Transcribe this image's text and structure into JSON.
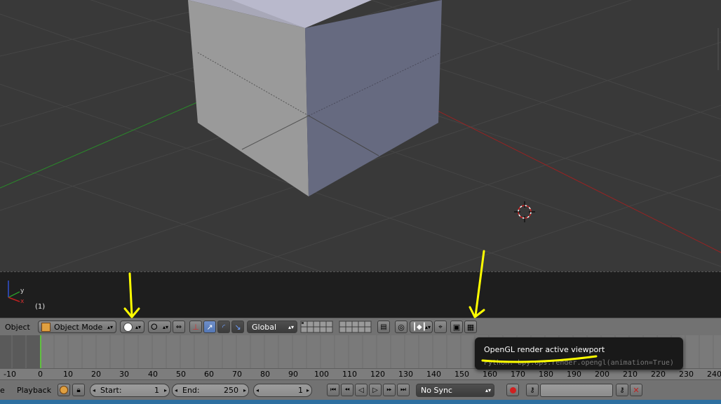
{
  "viewport": {
    "frame_indicator": "(1)",
    "axis_labels": {
      "x": "x",
      "y": "y"
    }
  },
  "header3d": {
    "editor_label": "Object",
    "mode_label": "Object Mode",
    "orientation_label": "Global"
  },
  "tooltip": {
    "title": "OpenGL render active viewport",
    "python": "Python: bpy.ops.render.opengl(animation=True)"
  },
  "timeline": {
    "ruler_ticks": [
      "-10",
      "0",
      "10",
      "20",
      "30",
      "40",
      "50",
      "60",
      "70",
      "80",
      "90",
      "100",
      "110",
      "120",
      "130",
      "140",
      "150",
      "160",
      "170",
      "180",
      "190",
      "200",
      "210",
      "220",
      "230",
      "240"
    ],
    "current_frame": 1
  },
  "footer": {
    "menu_partial": "e",
    "playback_label": "Playback",
    "start_label": "Start:",
    "start_value": "1",
    "end_label": "End:",
    "end_value": "250",
    "current_value": "1",
    "sync_label": "No Sync"
  },
  "icons": [
    "cube-icon",
    "shading-solid-icon",
    "pivot-icon",
    "manipulator-icon",
    "layers-grid-icon",
    "lock-icon",
    "opengl-render-image-icon",
    "opengl-render-animation-icon",
    "record-icon",
    "key-icon",
    "keyframe-delete-icon",
    "play-icon",
    "jump-start-icon",
    "jump-end-icon"
  ],
  "colors": {
    "annotation_arrow": "#ffff00",
    "x_axis": "#a02020",
    "y_axis": "#2a8a2a",
    "current_frame_line": "#60c040"
  }
}
